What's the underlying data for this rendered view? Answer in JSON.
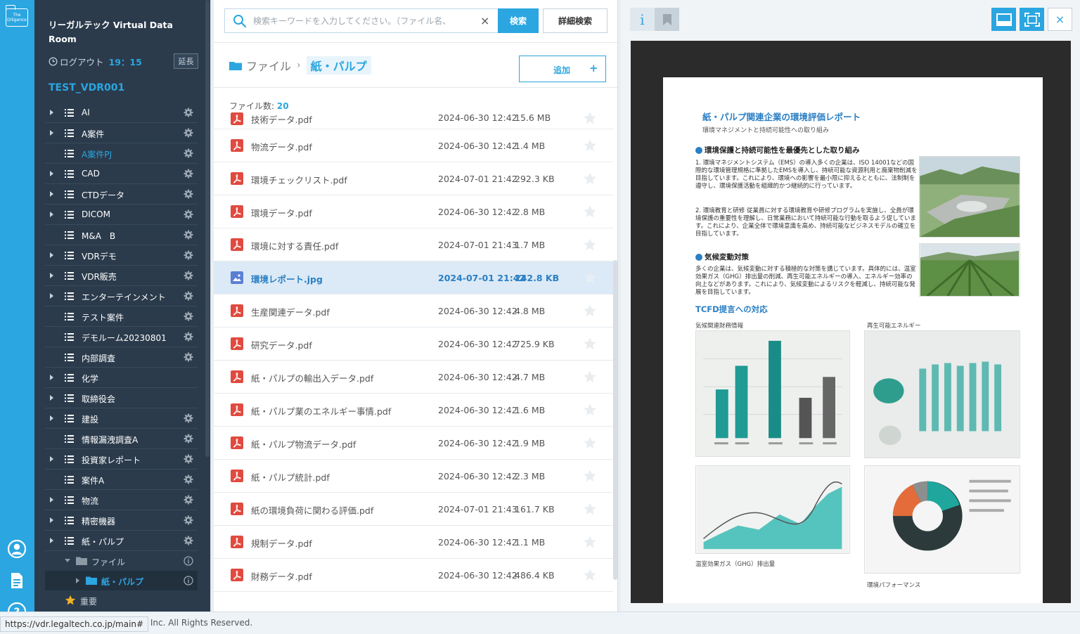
{
  "rail": {
    "logo_text": "The Diligence"
  },
  "sidebar": {
    "brand": "リーガルテック Virtual Data Room",
    "logout_label": "ログアウト",
    "logout_time": "19：15",
    "extend_label": "延長",
    "vdr_name": "TEST_VDR001",
    "items": [
      {
        "label": "AI",
        "caret": true
      },
      {
        "label": "A案件",
        "caret": true
      },
      {
        "label": "A案件PJ",
        "caret": false,
        "active": true
      },
      {
        "label": "CAD",
        "caret": true
      },
      {
        "label": "CTDデータ",
        "caret": true
      },
      {
        "label": "DICOM",
        "caret": true
      },
      {
        "label": "M&A　B",
        "caret": false
      },
      {
        "label": "VDRデモ",
        "caret": true
      },
      {
        "label": "VDR販売",
        "caret": true
      },
      {
        "label": "エンターテインメント",
        "caret": true
      },
      {
        "label": "テスト案件",
        "caret": false
      },
      {
        "label": "デモルーム20230801",
        "caret": false
      },
      {
        "label": "内部調査",
        "caret": false
      },
      {
        "label": "化学",
        "caret": true,
        "nogear": true
      },
      {
        "label": "取締役会",
        "caret": true,
        "nogear": true
      },
      {
        "label": "建設",
        "caret": true
      },
      {
        "label": "情報漏洩調査A",
        "caret": false
      },
      {
        "label": "投資家レポート",
        "caret": true
      },
      {
        "label": "案件A",
        "caret": false
      },
      {
        "label": "物流",
        "caret": true
      },
      {
        "label": "精密機器",
        "caret": true
      },
      {
        "label": "紙・パルプ",
        "caret": true
      }
    ],
    "sub_folder": "ファイル",
    "sub_current": "紙・パルプ",
    "favorite": "重要"
  },
  "search": {
    "placeholder": "検索キーワードを入力してください。（ファイル名、",
    "clear": "×",
    "button": "検索",
    "advanced": "詳細検索"
  },
  "breadcrumb": {
    "root": "ファイル",
    "sep": "›",
    "current": "紙・パルプ"
  },
  "add_button": {
    "label": "追加",
    "plus": "+"
  },
  "file_count": {
    "label": "ファイル数:",
    "value": "20"
  },
  "files": [
    {
      "name": "技術データ.pdf",
      "date": "2024-06-30 12:42",
      "size": "15.6 MB",
      "type": "pdf"
    },
    {
      "name": "物流データ.pdf",
      "date": "2024-06-30 12:42",
      "size": "1.4 MB",
      "type": "pdf"
    },
    {
      "name": "環境チェックリスト.pdf",
      "date": "2024-07-01 21:42",
      "size": "292.3 KB",
      "type": "pdf"
    },
    {
      "name": "環境データ.pdf",
      "date": "2024-06-30 12:42",
      "size": "2.8 MB",
      "type": "pdf"
    },
    {
      "name": "環境に対する責任.pdf",
      "date": "2024-07-01 21:43",
      "size": "1.7 MB",
      "type": "pdf"
    },
    {
      "name": "環境レポート.jpg",
      "date": "2024-07-01 21:42",
      "size": "242.8 KB",
      "type": "img",
      "selected": true
    },
    {
      "name": "生産関連データ.pdf",
      "date": "2024-06-30 12:42",
      "size": "4.8 MB",
      "type": "pdf"
    },
    {
      "name": "研究データ.pdf",
      "date": "2024-06-30 12:42",
      "size": "725.9 KB",
      "type": "pdf"
    },
    {
      "name": "紙・パルプの輸出入データ.pdf",
      "date": "2024-06-30 12:42",
      "size": "4.7 MB",
      "type": "pdf"
    },
    {
      "name": "紙・パルプ業のエネルギー事情.pdf",
      "date": "2024-06-30 12:42",
      "size": "1.6 MB",
      "type": "pdf"
    },
    {
      "name": "紙・パルプ物流データ.pdf",
      "date": "2024-06-30 12:42",
      "size": "1.9 MB",
      "type": "pdf"
    },
    {
      "name": "紙・パルプ統計.pdf",
      "date": "2024-06-30 12:42",
      "size": "2.3 MB",
      "type": "pdf"
    },
    {
      "name": "紙の環境負荷に関わる評価.pdf",
      "date": "2024-07-01 21:43",
      "size": "161.7 KB",
      "type": "pdf"
    },
    {
      "name": "規制データ.pdf",
      "date": "2024-06-30 12:42",
      "size": "1.1 MB",
      "type": "pdf"
    },
    {
      "name": "財務データ.pdf",
      "date": "2024-06-30 12:42",
      "size": "486.4 KB",
      "type": "pdf"
    }
  ],
  "preview": {
    "info_label": "i",
    "close": "×",
    "doc": {
      "title": "紙・パルプ関連企業の環境評価レポート",
      "subtitle": "環境マネジメントと持続可能性への取り組み",
      "h1": "環境保護と持続可能性を最優先とした取り組み",
      "p1": "1. 環境マネジメントシステム（EMS）の導入多くの企業は、ISO 14001などの国際的な環境管理規格に準拠したEMSを導入し、持続可能な資源利用と廃棄物削減を目指しています。これにより、環境への影響を最小限に抑えるとともに、法制制を遵守し、環境保護活動を組織的かつ継続的に行っています。",
      "p2": "2. 環境教育と研修 従業員に対する環境教育や研修プログラムを実施し、全員が環境保護の重要性を理解し、日常業務において持続可能な行動を取るよう促しています。これにより、企業全体で環境意識を高め、持続可能なビジネスモデルの確立を目指しています。",
      "h2": "気候変動対策",
      "p3": "多くの企業は、気候変動に対する積極的な対策を講じています。具体的には、温室効果ガス（GHG）排出量の削減、再生可能エネルギーの導入、エネルギー効率の向上などがあります。これにより、気候変動によるリスクを軽減し、持続可能な発展を目指しています。",
      "h3": "TCFD提言への対応",
      "cap1": "気候関連財務情報",
      "cap2": "再生可能エネルギー",
      "cap3": "温室効果ガス（GHG）排出量",
      "cap4": "環境パフォーマンス"
    }
  },
  "status": {
    "url": "https://vdr.legaltech.co.jp/main#",
    "copyright": "ch, Inc. All Rights Reserved."
  },
  "colors": {
    "accent": "#2ba6e0",
    "sidebar": "#2b3b4c",
    "pdf_red": "#e04a3f",
    "selected_row": "#dbeaf6"
  }
}
